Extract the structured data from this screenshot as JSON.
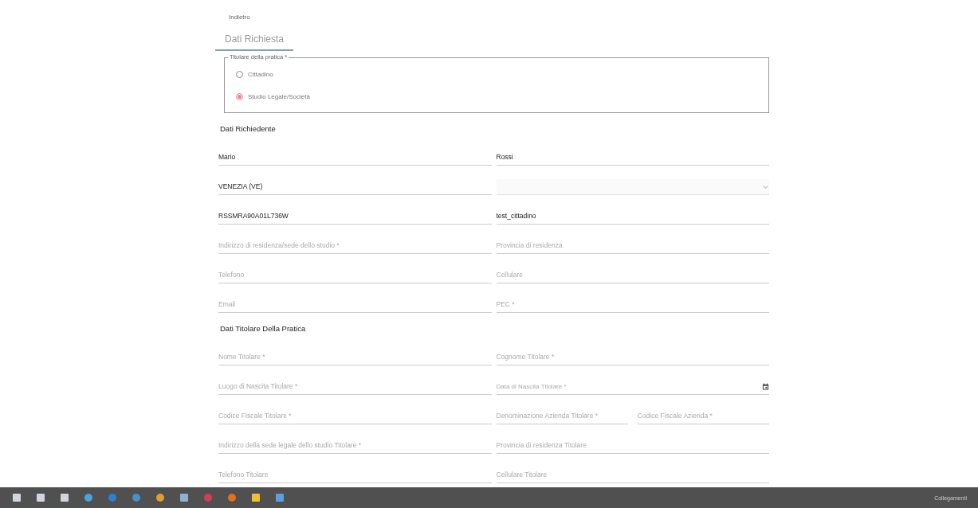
{
  "back_link": "Indietro",
  "tabs": [
    {
      "label": "Dati Richiesta",
      "selected": true
    }
  ],
  "holder_type": {
    "legend": "Titolare della pratica *",
    "options": [
      {
        "label": "Cittadino",
        "selected": false
      },
      {
        "label": "Studio Legale/Società",
        "selected": true
      }
    ]
  },
  "sections": [
    {
      "title": "Dati Richiedente",
      "fields": [
        {
          "kind": "text",
          "value": "Mario"
        },
        {
          "kind": "text",
          "value": "Rossi"
        },
        {
          "kind": "text",
          "value": "VENEZIA (VE)"
        },
        {
          "kind": "select",
          "disabled": true
        },
        {
          "kind": "text",
          "value": "RSSMRA90A01L736W"
        },
        {
          "kind": "text",
          "value": "test_cittadino"
        },
        {
          "kind": "text",
          "placeholder": "Indirizzo di residenza/sede dello studio *"
        },
        {
          "kind": "text",
          "placeholder": "Provincia di residenza"
        },
        {
          "kind": "text",
          "placeholder": "Telefono"
        },
        {
          "kind": "text",
          "placeholder": "Cellulare"
        },
        {
          "kind": "text",
          "placeholder": "Email"
        },
        {
          "kind": "text",
          "placeholder": "PEC *"
        }
      ]
    },
    {
      "title": "Dati Titolare Della Pratica",
      "fields": [
        {
          "kind": "text",
          "placeholder": "Nome Titolare *"
        },
        {
          "kind": "text",
          "placeholder": "Cognome Titolare *"
        },
        {
          "kind": "text",
          "placeholder": "Luogo di Nascita Titolare *"
        },
        {
          "kind": "date",
          "placeholder": "Data di Nascita Titolare *"
        },
        {
          "kind": "text",
          "placeholder": "Codice Fiscale Titolare *"
        },
        {
          "kind": "pair",
          "items": [
            {
              "placeholder": "Denominazione Azienda Titolare *"
            },
            {
              "placeholder": "Codice Fiscale Azienda *"
            }
          ]
        },
        {
          "kind": "text",
          "placeholder": "Indirizzo della sede legale dello studio Titolare *"
        },
        {
          "kind": "text",
          "placeholder": "Provincia di residenza Titolare"
        },
        {
          "kind": "text",
          "placeholder": "Telefono Titolare"
        },
        {
          "kind": "text",
          "placeholder": "Cellulare Titolare"
        }
      ]
    }
  ],
  "taskbar": {
    "tray_label": "Collegamenti"
  }
}
